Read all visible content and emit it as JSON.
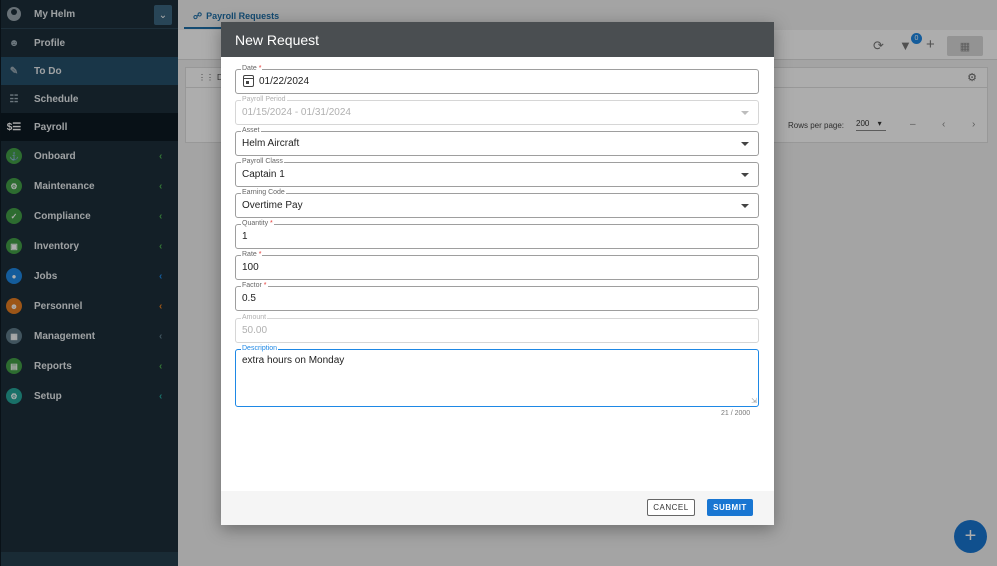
{
  "sidebar": {
    "user_name": "My Helm",
    "items": [
      {
        "label": "Profile",
        "icon": "profile-icon"
      },
      {
        "label": "To Do",
        "icon": "todo-icon"
      },
      {
        "label": "Schedule",
        "icon": "schedule-icon"
      },
      {
        "label": "Payroll",
        "icon": "payroll-icon"
      }
    ],
    "groups": [
      {
        "label": "Onboard",
        "color": "#43a047"
      },
      {
        "label": "Maintenance",
        "color": "#43a047"
      },
      {
        "label": "Compliance",
        "color": "#43a047"
      },
      {
        "label": "Inventory",
        "color": "#43a047"
      },
      {
        "label": "Jobs",
        "color": "#1e88e5"
      },
      {
        "label": "Personnel",
        "color": "#e67e22"
      },
      {
        "label": "Management",
        "color": "#607d8b"
      },
      {
        "label": "Reports",
        "color": "#43a047"
      },
      {
        "label": "Setup",
        "color": "#26a69a"
      }
    ]
  },
  "main": {
    "tab_label": "Payroll Requests",
    "filter_badge": "0",
    "column_header": "Dat",
    "rows_per_page_label": "Rows per page:",
    "rows_per_page_value": "200",
    "range_text": "–"
  },
  "dialog": {
    "title": "New Request",
    "fields": {
      "date": {
        "label": "Date",
        "value": "01/22/2024"
      },
      "payroll_period": {
        "label": "Payroll Period",
        "value": "01/15/2024 - 01/31/2024"
      },
      "asset": {
        "label": "Asset",
        "value": "Helm Aircraft"
      },
      "payroll_class": {
        "label": "Payroll Class",
        "value": "Captain 1"
      },
      "earning_code": {
        "label": "Earning Code",
        "value": "Overtime Pay"
      },
      "quantity": {
        "label": "Quantity",
        "value": "1"
      },
      "rate": {
        "label": "Rate",
        "value": "100"
      },
      "factor": {
        "label": "Factor",
        "value": "0.5"
      },
      "amount": {
        "label": "Amount",
        "value": "50.00"
      },
      "description": {
        "label": "Description",
        "value": "extra hours on Monday"
      }
    },
    "required_mark": "*",
    "char_counter": "21 / 2000",
    "cancel_label": "CANCEL",
    "submit_label": "SUBMIT"
  }
}
